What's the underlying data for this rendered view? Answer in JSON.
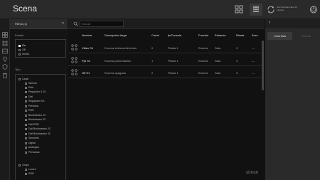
{
  "header": {
    "title": "Scena",
    "sync_text": "Sincronizado hace 10 minutos",
    "icons": [
      "grid-view-icon",
      "list-view-icon",
      "sync-icon",
      "power-icon"
    ]
  },
  "sidebar_icons": [
    "grid-icon",
    "scene-icon",
    "devices-icon",
    "location-icon",
    "shield-icon",
    "trash-icon"
  ],
  "filters": {
    "header_label": "Filtros (1)",
    "close_symbol": "×",
    "estado": {
      "title": "Estado",
      "items": [
        {
          "label": "On",
          "checked": true
        },
        {
          "label": "Off",
          "checked": false
        },
        {
          "label": "Averia",
          "checked": false
        }
      ]
    },
    "tipo": {
      "title": "Tipo",
      "groups": [
        {
          "label": "Canal",
          "items": [
            "Dimmer",
            "Relé",
            "Regulador 0-10",
            "Dali",
            "Regulador Ext.",
            "Persiana",
            "RGB",
            "Biodinámico 2C",
            "Biodinámico 3C",
            "Dali RGB",
            "Dali Biodinámico 2C",
            "Dali Biodinámico 3C",
            "Sensores",
            "Digital",
            "Analógico",
            "Persianas"
          ]
        },
        {
          "label": "Grupo",
          "items": [
            "Lumen",
            "RGB"
          ]
        }
      ]
    }
  },
  "search": {
    "placeholder": "Buscar",
    "value": ""
  },
  "table": {
    "columns": [
      "Nombre",
      "Descripción larga",
      "Canal",
      "Ip/Consola",
      "Función",
      "Estancia",
      "Planta",
      "Área"
    ],
    "rows": [
      [
        "Video S1",
        "Escena videoconferencia",
        "0",
        "Planta 1",
        "Escena",
        "Sala",
        "3",
        "—"
      ],
      [
        "Ppt S1",
        "Escena presentación",
        "1",
        "Planta 1",
        "Escena",
        "Sala",
        "3",
        "—"
      ],
      [
        "Off S1",
        "Escena apagado",
        "2",
        "Planta 1",
        "Escena",
        "Sala",
        "3",
        "—"
      ]
    ]
  },
  "brand": "simon",
  "right_panel": {
    "back_symbol": "‹",
    "tabs": [
      "Controles",
      "Acceso"
    ],
    "active_tab": 0
  }
}
